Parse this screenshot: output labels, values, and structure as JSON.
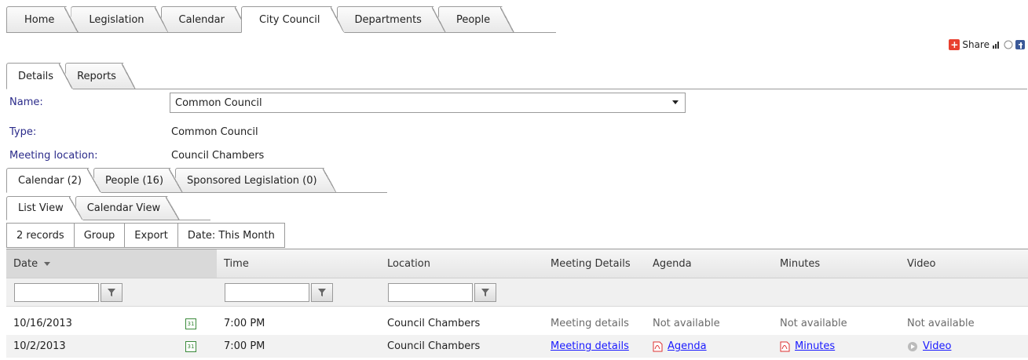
{
  "top_tabs": [
    {
      "label": "Home",
      "active": false
    },
    {
      "label": "Legislation",
      "active": false
    },
    {
      "label": "Calendar",
      "active": false
    },
    {
      "label": "City Council",
      "active": true
    },
    {
      "label": "Departments",
      "active": false
    },
    {
      "label": "People",
      "active": false
    }
  ],
  "share": {
    "label": "Share"
  },
  "detail_tabs": [
    {
      "label": "Details",
      "active": true
    },
    {
      "label": "Reports",
      "active": false
    }
  ],
  "details": {
    "name_label": "Name:",
    "name_value": "Common Council",
    "type_label": "Type:",
    "type_value": "Common Council",
    "location_label": "Meeting location:",
    "location_value": "Council Chambers"
  },
  "sub_tabs": [
    {
      "label": "Calendar (2)",
      "active": true
    },
    {
      "label": "People (16)",
      "active": false
    },
    {
      "label": "Sponsored Legislation (0)",
      "active": false
    }
  ],
  "view_tabs": [
    {
      "label": "List View",
      "active": true
    },
    {
      "label": "Calendar View",
      "active": false
    }
  ],
  "toolbar": {
    "records": "2 records",
    "group": "Group",
    "export": "Export",
    "date_filter": "Date: This Month"
  },
  "grid": {
    "columns": [
      "Date",
      "Time",
      "Location",
      "Meeting Details",
      "Agenda",
      "Minutes",
      "Video"
    ],
    "rows": [
      {
        "date": "10/16/2013",
        "time": "7:00 PM",
        "location": "Council Chambers",
        "meeting_details": "Meeting details",
        "agenda": "Not available",
        "minutes": "Not available",
        "video": "Not available"
      },
      {
        "date": "10/2/2013",
        "time": "7:00 PM",
        "location": "Council Chambers",
        "meeting_details": "Meeting details",
        "agenda": "Agenda",
        "minutes": "Minutes",
        "video": "Video"
      }
    ],
    "calendar_icon_text": "31"
  },
  "colors": {
    "label": "#2b2b8a",
    "link": "#1a1aff",
    "border": "#9a9a9a",
    "pdf": "#d33",
    "calendar": "#3a8a3a"
  }
}
